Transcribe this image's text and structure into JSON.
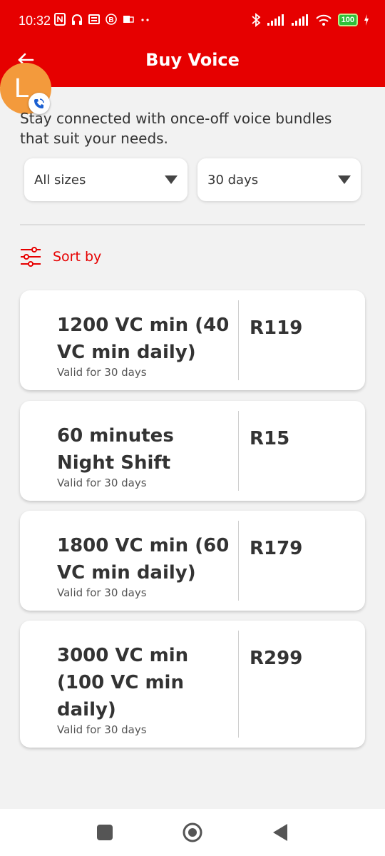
{
  "status_bar": {
    "time": "10:32",
    "battery": "100",
    "icons": [
      "nfc-icon",
      "headset-icon",
      "news-icon",
      "b-icon",
      "outlook-icon",
      "more-dots-icon",
      "bluetooth-icon",
      "signal-icon",
      "signal-icon",
      "wifi-icon",
      "battery-icon",
      "charging-icon"
    ],
    "background": "#e60000"
  },
  "header": {
    "title": "Buy Voice",
    "back_icon": "back-arrow-icon"
  },
  "avatar": {
    "initial": "L",
    "badge_icon": "phone-call-icon",
    "color": "#f39a3c"
  },
  "intro": "Stay connected with once-off voice bundles that suit your needs.",
  "filters": {
    "size": "All sizes",
    "validity": "30 days"
  },
  "sort": {
    "label": "Sort by",
    "icon": "sliders-icon"
  },
  "bundles": [
    {
      "title": "1200 VC min (40 VC min daily)",
      "validity": "Valid for 30 days",
      "price": "R119"
    },
    {
      "title": "60 minutes Night Shift",
      "validity": "Valid for 30 days",
      "price": "R15"
    },
    {
      "title": "1800 VC min (60 VC min daily)",
      "validity": "Valid for 30 days",
      "price": "R179"
    },
    {
      "title": "3000 VC min (100 VC min daily)",
      "validity": "Valid for 30 days",
      "price": "R299"
    }
  ],
  "nav": {
    "icons": [
      "recents-square-icon",
      "home-circle-icon",
      "back-triangle-icon"
    ]
  },
  "colors": {
    "accent": "#e60000",
    "background": "#f2f2f2",
    "card": "#ffffff"
  }
}
